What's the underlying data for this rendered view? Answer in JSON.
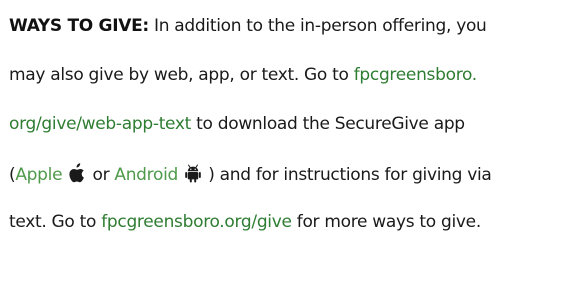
{
  "heading": "WAYS TO GIVE:",
  "lines": {
    "l1_text": " In addition to the in-person offering, you",
    "l2_text": "may also give by web, app, or text. Go to ",
    "l2_link": "fpcgreensboro.",
    "l3_link": "org/give/web-app-text",
    "l3_text": " to download the SecureGive app",
    "l4_open": "(",
    "l4_apple": "Apple",
    "l4_or": " or ",
    "l4_android": "Android",
    "l4_rest": " ) and for instructions for giving via",
    "l5_text": "text. Go to ",
    "l5_link": "fpcgreensboro.org/give",
    "l5_rest": " for more ways to give."
  },
  "icons": {
    "apple": "apple-icon",
    "android": "android-icon"
  },
  "colors": {
    "link": "#2e7d32",
    "link_light": "#4e9a4a",
    "text": "#1a1a1a"
  }
}
